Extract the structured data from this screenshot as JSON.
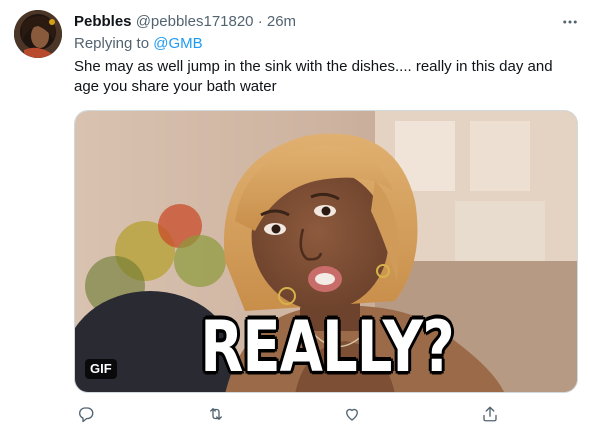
{
  "tweet": {
    "display_name": "Pebbles",
    "handle": "@pebbles171820",
    "separator": "·",
    "time": "26m",
    "replying_prefix": "Replying to ",
    "replying_mention": "@GMB",
    "text": "She may as well jump in the sink with the dishes.... really in this day and age you share your bath water",
    "media": {
      "caption": "REALLY?",
      "badge": "GIF"
    },
    "more_icon": "more-horizontal-icon"
  },
  "actions": [
    {
      "name": "reply",
      "icon": "reply-icon"
    },
    {
      "name": "retweet",
      "icon": "retweet-icon"
    },
    {
      "name": "like",
      "icon": "heart-icon"
    },
    {
      "name": "share",
      "icon": "share-icon"
    }
  ],
  "colors": {
    "link": "#1d9bf0",
    "secondary_text": "#536471",
    "primary_text": "#0f1419"
  }
}
